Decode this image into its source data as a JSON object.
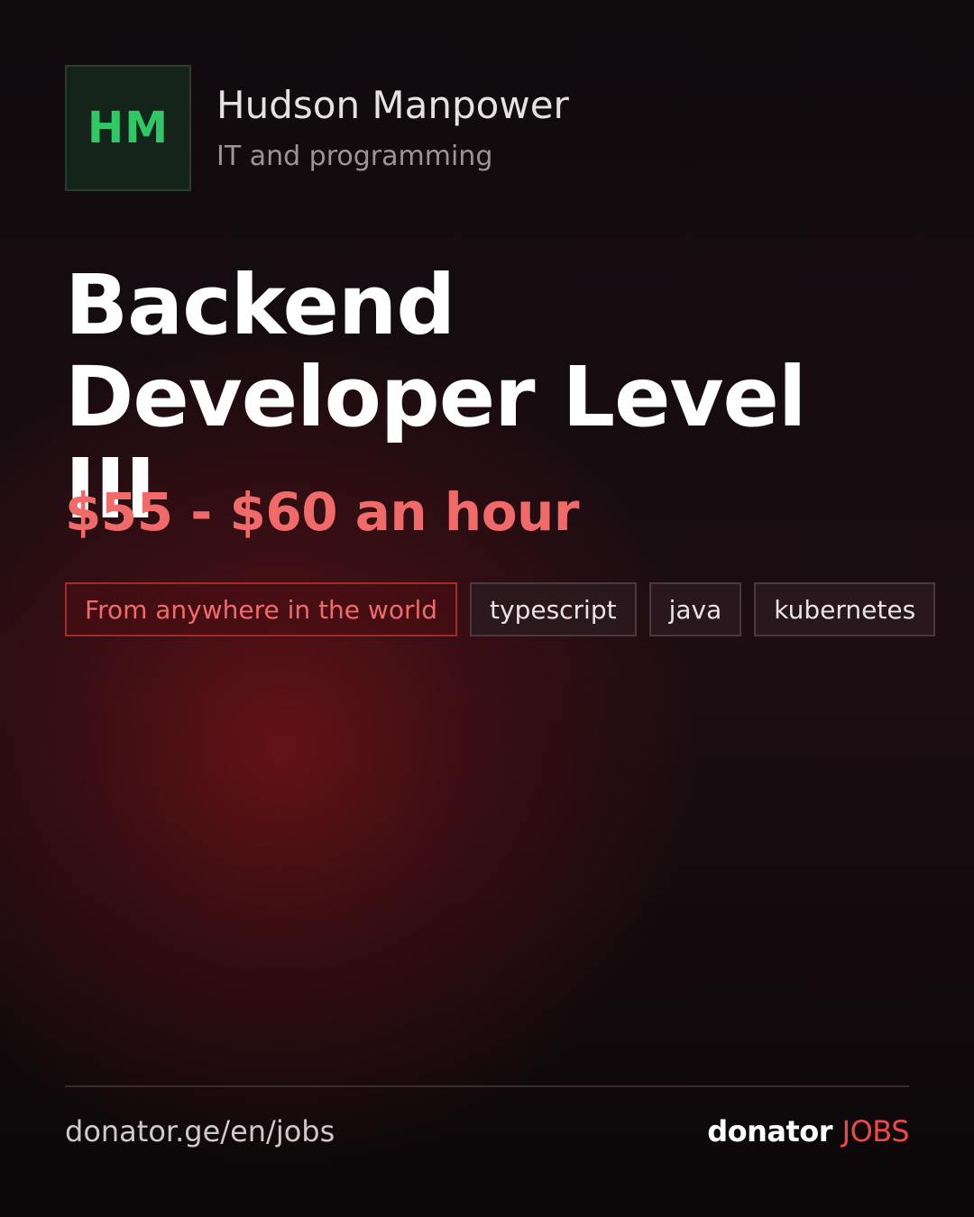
{
  "company": {
    "logo_initials": "HM",
    "name": "Hudson Manpower",
    "category": "IT and programming"
  },
  "job": {
    "title": "Backend Developer Level III",
    "salary": "$55 - $60 an hour"
  },
  "tags": {
    "location": "From anywhere in the world",
    "skills": [
      "typescript",
      "java",
      "kubernetes"
    ]
  },
  "footer": {
    "url": "donator.ge/en/jobs",
    "brand_name": "donator",
    "brand_suffix": "JOBS"
  },
  "colors": {
    "accent": "#f06a6a",
    "logo_text": "#2fc864",
    "brand_suffix": "#f04848"
  }
}
